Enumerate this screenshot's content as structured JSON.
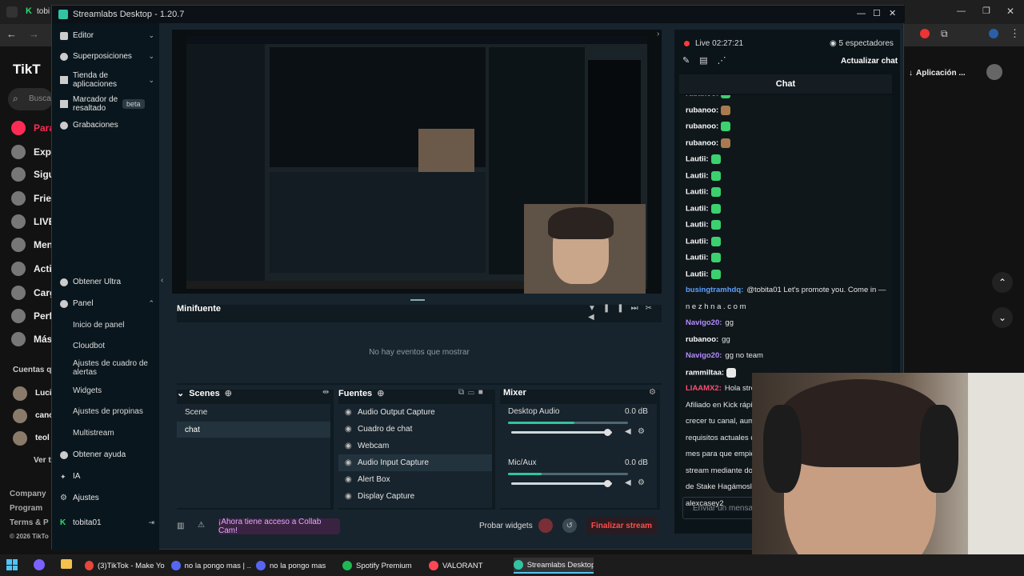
{
  "browser": {
    "tab_title": "tobi",
    "toolbar_right_button": "Aplicación ...",
    "tiktok": {
      "logo": "TikT",
      "search_placeholder": "Busca",
      "nav": [
        "Para",
        "Expl",
        "Sigu",
        "Frie",
        "LIVE",
        "Men",
        "Acti",
        "Carg",
        "Perf",
        "Más"
      ],
      "following_header": "Cuentas que",
      "following": [
        "Luci",
        "canc",
        "teol"
      ],
      "see_all": "Ver t",
      "footer": [
        "Company",
        "Program",
        "Terms & P",
        "© 2026 TikTo"
      ]
    }
  },
  "streamlabs": {
    "title": "Streamlabs Desktop - 1.20.7",
    "sidebar": {
      "items": [
        {
          "label": "Editor"
        },
        {
          "label": "Superposiciones"
        },
        {
          "label": "Tienda de aplicaciones"
        },
        {
          "label": "Marcador de resaltado",
          "badge": "beta"
        },
        {
          "label": "Grabaciones"
        },
        {
          "label": "Obtener Ultra"
        },
        {
          "label": "Panel"
        }
      ],
      "panel_subitems": [
        "Inicio de panel",
        "Cloudbot",
        "Ajustes de cuadro de alertas",
        "Widgets",
        "Ajustes de propinas",
        "Multistream"
      ],
      "bottom_items": [
        "Obtener ayuda",
        "IA",
        "Ajustes",
        "tobita01"
      ]
    },
    "minifuente": {
      "title": "Minifuente",
      "empty": "No hay eventos que mostrar"
    },
    "scenes": {
      "title": "Scenes",
      "items": [
        "Scene",
        "chat"
      ]
    },
    "sources": {
      "title": "Fuentes",
      "items": [
        "Audio Output Capture",
        "Cuadro de chat",
        "Webcam",
        "Audio Input Capture",
        "Alert Box",
        "Display Capture"
      ]
    },
    "mixer": {
      "title": "Mixer",
      "channels": [
        {
          "name": "Desktop Audio",
          "db": "0.0 dB",
          "level": 0.55,
          "volume": 0.95
        },
        {
          "name": "Mic/Aux",
          "db": "0.0 dB",
          "level": 0.28,
          "volume": 0.95
        }
      ]
    },
    "footer": {
      "collab": "¡Ahora tiene acceso a Collab Cam!",
      "test_widgets": "Probar widgets",
      "end_stream": "Finalizar stream"
    },
    "chat": {
      "live_label": "Live",
      "live_time": "02:27:21",
      "viewers": "5 espectadores",
      "refresh": "Actualizar chat",
      "header": "Chat",
      "messages": [
        {
          "user": "rubanoo:",
          "text": "",
          "emote": "green",
          "user_color": "#ffffff"
        },
        {
          "user": "rubanoo:",
          "text": "",
          "emote": "brown",
          "user_color": "#ffffff"
        },
        {
          "user": "rubanoo:",
          "text": "",
          "emote": "green",
          "user_color": "#ffffff"
        },
        {
          "user": "rubanoo:",
          "text": "",
          "emote": "brown",
          "user_color": "#ffffff"
        },
        {
          "user": "Lautii:",
          "text": "",
          "emote": "green",
          "user_color": "#ffffff"
        },
        {
          "user": "Lautii:",
          "text": "",
          "emote": "green",
          "user_color": "#ffffff"
        },
        {
          "user": "Lautii:",
          "text": "",
          "emote": "green",
          "user_color": "#ffffff"
        },
        {
          "user": "Lautii:",
          "text": "",
          "emote": "green",
          "user_color": "#ffffff"
        },
        {
          "user": "Lautii:",
          "text": "",
          "emote": "green",
          "user_color": "#ffffff"
        },
        {
          "user": "Lautii:",
          "text": "",
          "emote": "green",
          "user_color": "#ffffff"
        },
        {
          "user": "Lautii:",
          "text": "",
          "emote": "green",
          "user_color": "#ffffff"
        },
        {
          "user": "Lautii:",
          "text": "",
          "emote": "green",
          "user_color": "#ffffff"
        },
        {
          "user": "busingtramhdq:",
          "text": "@tobita01 Let's promote you. Come in —",
          "emote": "",
          "user_color": "#5aa0ff"
        },
        {
          "user": "",
          "text": "n e z h n a . c o m",
          "emote": "",
          "user_color": "#ffffff"
        },
        {
          "user": "Navigo20:",
          "text": "gg",
          "emote": "",
          "user_color": "#b48cff"
        },
        {
          "user": "rubanoo:",
          "text": "gg",
          "emote": "",
          "user_color": "#ffffff"
        },
        {
          "user": "Navigo20:",
          "text": "gg no team",
          "emote": "",
          "user_color": "#b48cff"
        },
        {
          "user": "rammiltaa:",
          "text": "",
          "emote": "white",
          "user_color": "#ffffff"
        },
        {
          "user": "LIAAMX2:",
          "text": "Hola stre",
          "emote": "",
          "user_color": "#ff4d6d"
        },
        {
          "user": "",
          "text": "Afiliado en Kick rápi",
          "emote": "",
          "user_color": "#ffffff"
        },
        {
          "user": "",
          "text": "crecer tu canal, aum",
          "emote": "",
          "user_color": "#ffffff"
        },
        {
          "user": "",
          "text": "requisitos actuales d",
          "emote": "",
          "user_color": "#ffffff"
        },
        {
          "user": "",
          "text": "mes para que empie",
          "emote": "",
          "user_color": "#ffffff"
        },
        {
          "user": "",
          "text": "stream mediante do",
          "emote": "",
          "user_color": "#ffffff"
        },
        {
          "user": "",
          "text": "de Stake Hagámoslo",
          "emote": "",
          "user_color": "#ffffff"
        },
        {
          "user": "",
          "text": "alexcasey2",
          "emote": "",
          "user_color": "#ffffff"
        }
      ],
      "input_placeholder": "Enviar un mensa"
    }
  },
  "taskbar": {
    "items": [
      {
        "label": "(3)TikTok - Make Yo...",
        "color": "#e8453c"
      },
      {
        "label": "no la pongo mas | ...",
        "color": "#5865f2"
      },
      {
        "label": "no la pongo mas",
        "color": "#5865f2"
      },
      {
        "label": "Spotify Premium",
        "color": "#1db954"
      },
      {
        "label": "VALORANT",
        "color": "#ff4655"
      },
      {
        "label": "Streamlabs Desktop",
        "color": "#31c3a2"
      }
    ]
  },
  "colors": {
    "accent": "#31c3a2",
    "danger": "#ff4d4d",
    "live": "#ff3b3b"
  }
}
